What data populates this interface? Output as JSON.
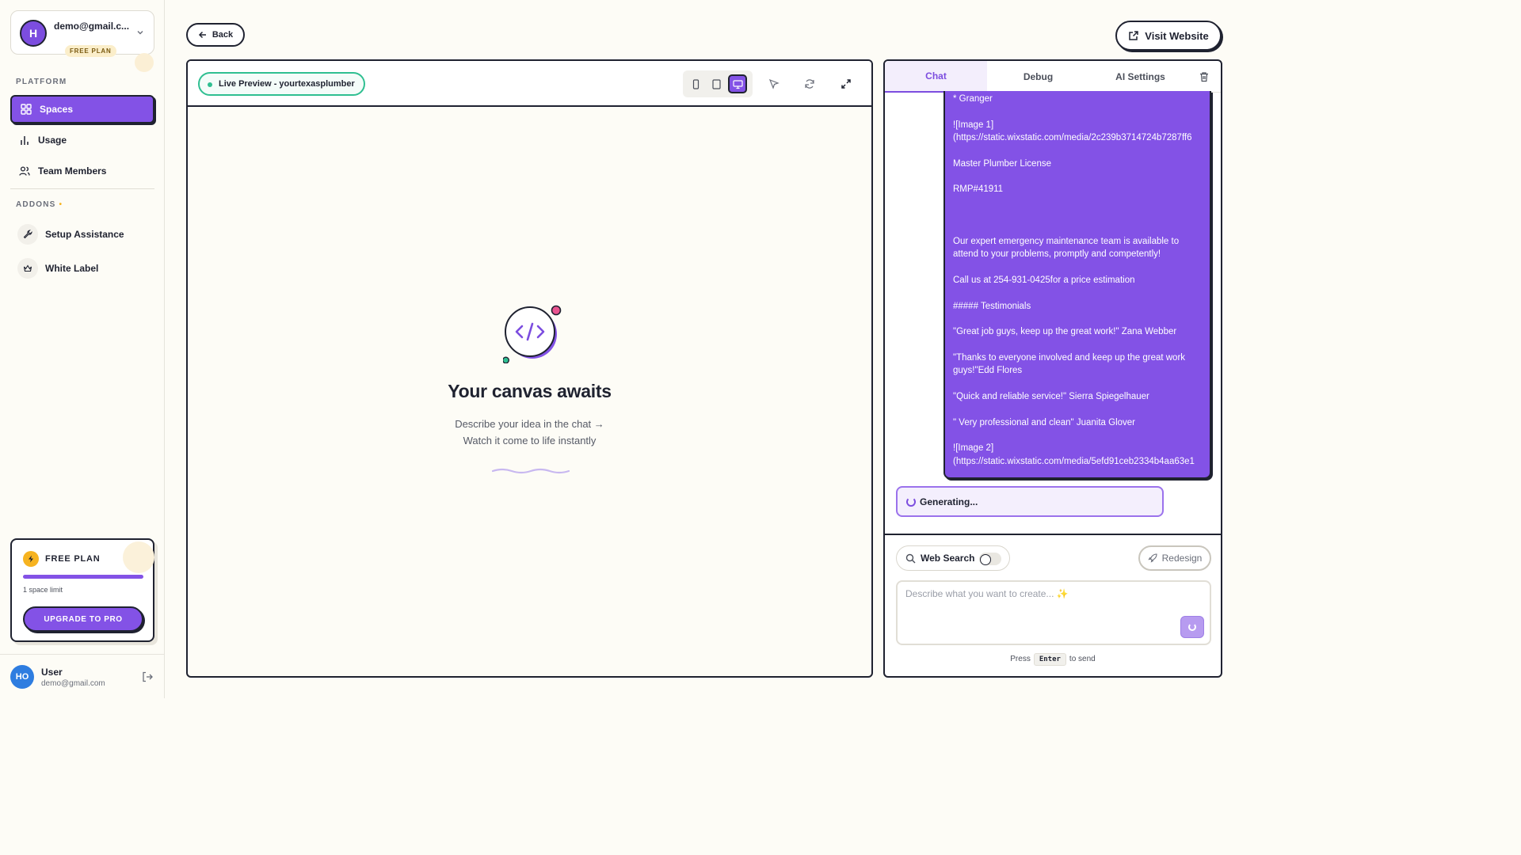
{
  "account": {
    "initial": "H",
    "email": "demo@gmail.c...",
    "plan_badge": "FREE PLAN"
  },
  "sidebar": {
    "platform_label": "PLATFORM",
    "items": [
      {
        "label": "Spaces",
        "icon": "grid-icon",
        "active": true
      },
      {
        "label": "Usage",
        "icon": "bar-chart-icon",
        "active": false
      },
      {
        "label": "Team Members",
        "icon": "users-icon",
        "active": false
      }
    ],
    "addons_label": "ADDONS",
    "addons": [
      {
        "label": "Setup Assistance",
        "icon": "wrench-icon"
      },
      {
        "label": "White Label",
        "icon": "crown-icon"
      }
    ]
  },
  "plan_card": {
    "title": "FREE PLAN",
    "limit_text": "1 space limit",
    "usage_fraction": 1.0,
    "upgrade_label": "UPGRADE TO PRO"
  },
  "user": {
    "initials": "HO",
    "name": "User",
    "email": "demo@gmail.com"
  },
  "header": {
    "back_label": "Back",
    "visit_label": "Visit Website"
  },
  "preview": {
    "live_label": "Live Preview - yourtexasplumber",
    "active_device": "desktop",
    "empty_title": "Your canvas awaits",
    "empty_line1": "Describe your idea in the chat →",
    "empty_line2": "Watch it come to life instantly"
  },
  "chat": {
    "tabs": [
      {
        "label": "Chat",
        "active": true
      },
      {
        "label": "Debug",
        "active": false
      },
      {
        "label": "AI Settings",
        "active": false
      }
    ],
    "message_lines": [
      "*   Granger",
      "",
      "![Image 1]",
      "(https://static.wixstatic.com/media/2c239b3714724b7287ff6",
      "",
      "Master Plumber License",
      "",
      "RMP#41911",
      "",
      "",
      "",
      "Our expert emergency maintenance team is available to",
      "attend to your problems, promptly and competently!",
      "",
      "Call us at 254-931-0425for a price estimation",
      "",
      "##### Testimonials",
      "",
      "\"Great job guys, keep up the great work!\" Zana Webber",
      "",
      "\"Thanks to everyone involved and keep up the great work",
      "guys!\"Edd Flores",
      "",
      "\"Quick and reliable service!\" Sierra Spiegelhauer",
      "",
      "\" Very professional and clean\" Juanita Glover",
      "",
      "![Image 2]",
      "(https://static.wixstatic.com/media/5efd91ceb2334b4aa63e1"
    ],
    "generating_label": "Generating...",
    "web_search_label": "Web Search",
    "web_search_on": false,
    "redesign_label": "Redesign",
    "input_placeholder": "Describe what you want to create... ✨",
    "input_value": "",
    "hint_press": "Press",
    "hint_key": "Enter",
    "hint_send": "to send"
  },
  "colors": {
    "accent": "#8352e6",
    "ink": "#1f2230",
    "live_green": "#2fbf91",
    "background": "#fdfcf6",
    "plan_yellow": "#f6b320"
  }
}
